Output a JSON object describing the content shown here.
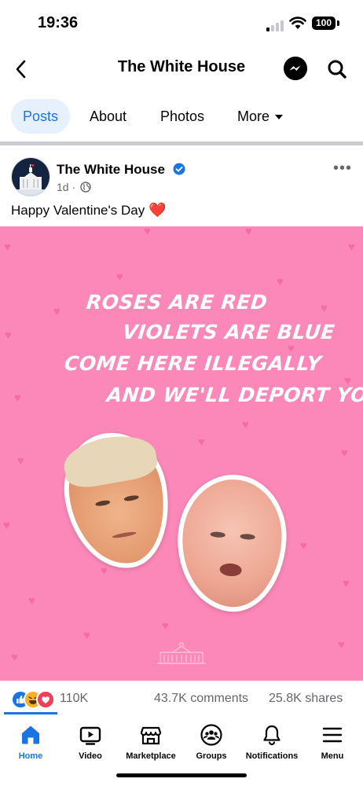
{
  "status": {
    "time": "19:36",
    "battery": "100"
  },
  "header": {
    "title": "The White House",
    "back_icon": "chevron-left-icon",
    "messenger_icon": "messenger-icon",
    "search_icon": "search-icon"
  },
  "tabs": [
    {
      "label": "Posts",
      "active": true
    },
    {
      "label": "About"
    },
    {
      "label": "Photos"
    },
    {
      "label": "More"
    }
  ],
  "post": {
    "author": "The White House",
    "time": "1d",
    "separator": "·",
    "text": "Happy Valentine's Day",
    "emoji": "❤️",
    "image": {
      "poem": [
        "ROSES ARE RED",
        "VIOLETS ARE BLUE",
        "COME HERE ILLEGALLY",
        "AND WE'LL DEPORT YOU"
      ],
      "background": "#fb88b8"
    },
    "reactions": {
      "count": "110K",
      "comments": "43.7K comments",
      "shares": "25.8K shares"
    }
  },
  "nav": [
    {
      "label": "Home",
      "icon": "home-icon",
      "active": true
    },
    {
      "label": "Video",
      "icon": "video-icon"
    },
    {
      "label": "Marketplace",
      "icon": "marketplace-icon"
    },
    {
      "label": "Groups",
      "icon": "groups-icon"
    },
    {
      "label": "Notifications",
      "icon": "bell-icon"
    },
    {
      "label": "Menu",
      "icon": "menu-icon"
    }
  ],
  "colors": {
    "accent": "#1b74e4",
    "image_pink": "#fb88b8",
    "heart": "#e0252f"
  }
}
